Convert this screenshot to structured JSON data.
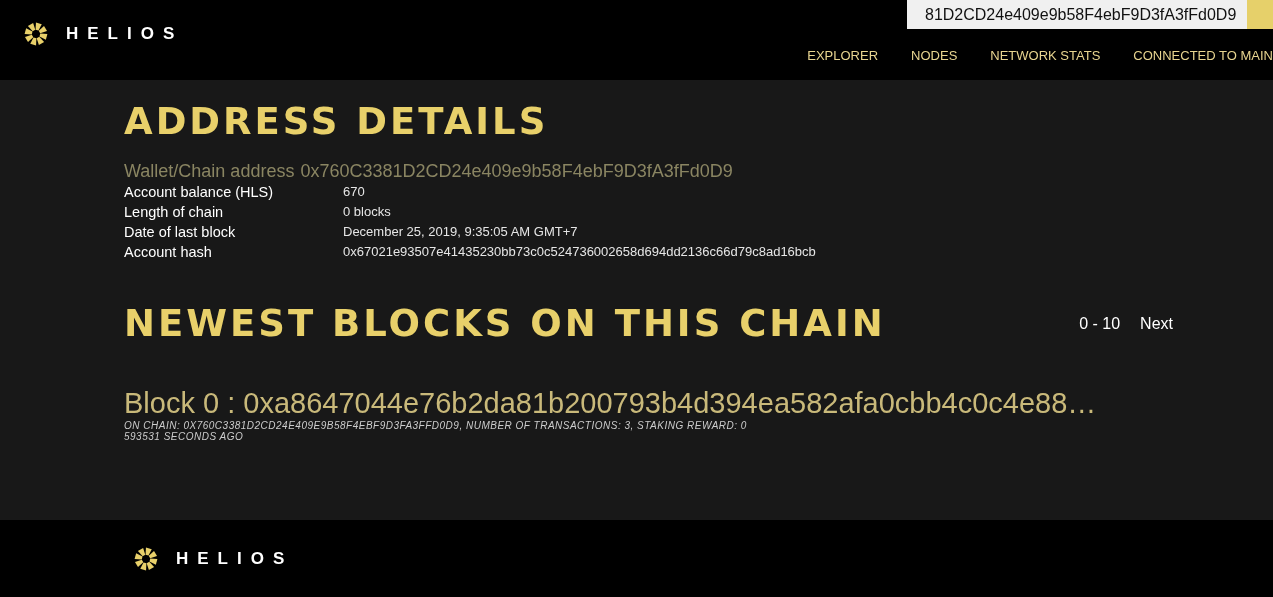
{
  "header": {
    "brand": "HELIOS",
    "search": {
      "value": "81D2CD24e409e9b58F4ebF9D3fA3fFd0D9"
    },
    "nav": [
      {
        "label": "EXPLORER"
      },
      {
        "label": "NODES"
      },
      {
        "label": "NETWORK STATS"
      },
      {
        "label": "CONNECTED TO MAIN"
      }
    ]
  },
  "address_details": {
    "title": "ADDRESS DETAILS",
    "address_label": "Wallet/Chain address",
    "address_value": "0x760C3381D2CD24e409e9b58F4ebF9D3fA3fFd0D9",
    "rows": [
      {
        "label": "Account balance (HLS)",
        "value": "670"
      },
      {
        "label": "Length of chain",
        "value": "0 blocks"
      },
      {
        "label": "Date of last block",
        "value": "December 25, 2019, 9:35:05 AM GMT+7"
      },
      {
        "label": "Account hash",
        "value": "0x67021e93507e41435230bb73c0c524736002658d694dd2136c66d79c8ad16bcb"
      }
    ]
  },
  "blocks": {
    "title": "NEWEST BLOCKS ON THIS CHAIN",
    "range": "0 - 10",
    "next": "Next",
    "items": [
      {
        "title": "Block 0 : 0xa8647044e76b2da81b200793b4d394ea582afa0cbb4c0c4e88…",
        "info": "ON CHAIN: 0X760C3381D2CD24E409E9B58F4EBF9D3FA3FFD0D9, NUMBER OF TRANSACTIONS: 3, STAKING REWARD: 0",
        "age": "593531 SECONDS AGO"
      }
    ]
  },
  "footer": {
    "brand": "HELIOS"
  }
}
